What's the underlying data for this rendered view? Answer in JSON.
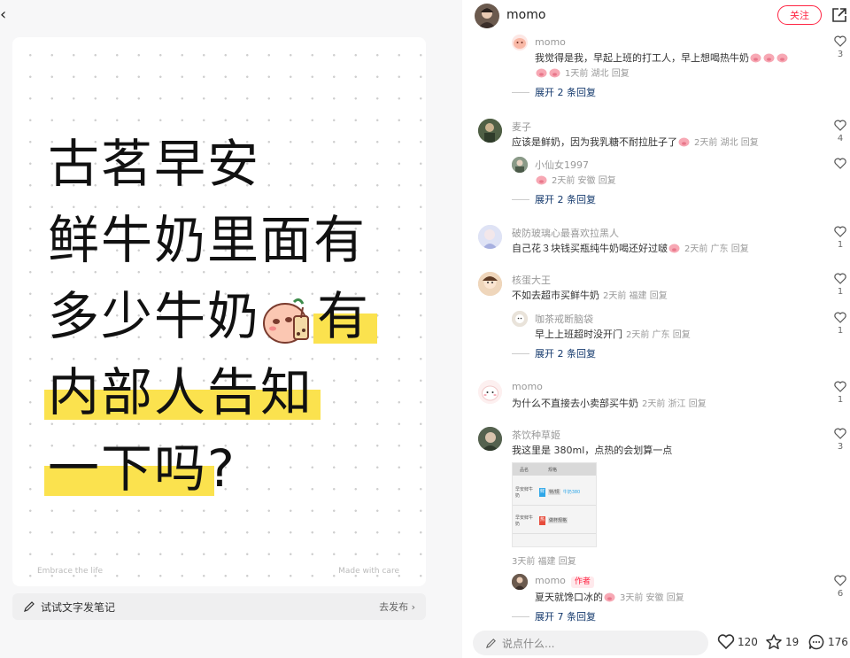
{
  "left": {
    "note_lines": [
      "古茗早安",
      "鲜牛奶里面有",
      "多少牛奶",
      "有",
      "内部人告知",
      "一下吗",
      "?"
    ],
    "footer_left": "Embrace the life",
    "footer_right": "Made with care",
    "bottom_bar": {
      "label": "试试文字发笔记",
      "publish": "去发布 ›"
    }
  },
  "header": {
    "username": "momo",
    "follow": "关注"
  },
  "comments": [
    {
      "name": "momo",
      "text": "我觉得是我，早起上班的打工人，早上想喝热牛奶",
      "meta": "1天前 湖北 回复",
      "likes": "3"
    },
    {
      "expand": "展开 2 条回复"
    },
    {
      "name": "麦子",
      "text": "应该是鲜奶，因为我乳糖不耐拉肚子了",
      "meta": "2天前 湖北 回复",
      "likes": "4"
    },
    {
      "name": "小仙女1997",
      "text": "",
      "meta": "2天前 安徽 回复",
      "likes": ""
    },
    {
      "expand": "展开 2 条回复"
    },
    {
      "name": "破防玻璃心最喜欢拉黑人",
      "text": "自己花３块钱买瓶纯牛奶喝还好过啵",
      "meta": "2天前 广东 回复",
      "likes": "1"
    },
    {
      "name": "核蛋大王",
      "text": "不如去超市买鲜牛奶",
      "meta": "2天前 福建 回复",
      "likes": "1"
    },
    {
      "name": "咖茶戒断脑袋",
      "text": "早上上班超时没开门",
      "meta": "2天前 广东 回复",
      "likes": "1"
    },
    {
      "expand": "展开 2 条回复"
    },
    {
      "name": "momo",
      "text": "为什么不直接去小卖部买牛奶",
      "meta": "2天前 浙江 回复",
      "likes": "1"
    },
    {
      "name": "茶饮种草姬",
      "text": "我这里是 380ml，点热的会划算一点",
      "meta": "3天前 福建 回复",
      "likes": "3"
    },
    {
      "name": "momo",
      "badge": "作者",
      "text": "夏天就馋口冰的",
      "meta": "3天前 安徽 回复",
      "likes": "6"
    },
    {
      "expand": "展开 7 条回复"
    }
  ],
  "comment_image": {
    "head": [
      "品名",
      "规格"
    ],
    "rows": [
      {
        "name": "早安鲜牛奶",
        "tag1": "鲜",
        "tag2": "特/规",
        "desc": "牛奶380"
      },
      {
        "name": "早安鲜牛奶",
        "tag1": "热",
        "tag2": "做杯规格"
      }
    ]
  },
  "footer": {
    "placeholder": "说点什么...",
    "likes": "120",
    "stars": "19",
    "comments": "176"
  },
  "colors": {
    "accent": "#ff2442",
    "link": "#13386c",
    "highlight": "#fbe24e"
  }
}
